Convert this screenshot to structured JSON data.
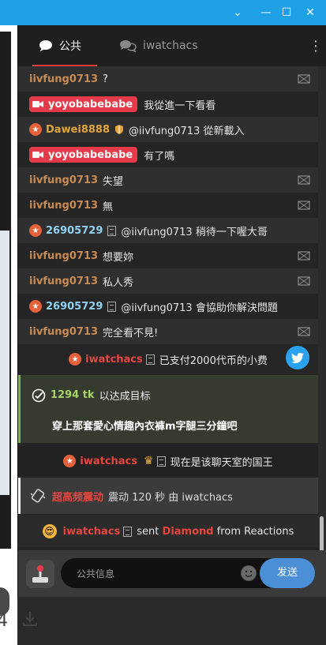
{
  "window": {
    "minimize": "⌄",
    "restore": "—",
    "maximize": "☐",
    "close": "✕"
  },
  "page": {
    "number_fragment": "4"
  },
  "tabs": [
    {
      "label": "公共"
    },
    {
      "label": "iwatchacs"
    }
  ],
  "messages": [
    {
      "user": "iivfung0713",
      "text": "?"
    },
    {
      "user": "yoyobabebabe",
      "text": "我從進一下看看"
    },
    {
      "user": "Dawei8888",
      "text": "@iivfung0713  從新載入"
    },
    {
      "user": "yoyobabebabe",
      "text": "有了嗎"
    },
    {
      "user": "iivfung0713",
      "text": "失望"
    },
    {
      "user": "iivfung0713",
      "text": "無"
    },
    {
      "user": "26905729",
      "text": "@iivfung0713  稍待一下喔大哥"
    },
    {
      "user": "iivfung0713",
      "text": "想要妳"
    },
    {
      "user": "iivfung0713",
      "text": "私人秀"
    },
    {
      "user": "26905729",
      "text": "@iivfung0713  會協助你解決問題"
    },
    {
      "user": "iivfung0713",
      "text": "完全看不見!"
    }
  ],
  "tip": {
    "user": "iwatchacs",
    "text": "已支付2000代币的小费"
  },
  "goal": {
    "amount": "1294 tk",
    "label": "以达成目标",
    "text": "穿上那套愛心情趣內衣褲m字腿三分鐘吧"
  },
  "king": {
    "user": "iwatchacs",
    "text": "现在是该聊天室的国王"
  },
  "vibe": {
    "title": "超高频震动",
    "text": "震动 120 秒 由 iwatchacs"
  },
  "gift": {
    "user": "iwatchacs",
    "sent": "sent",
    "item": "Diamond",
    "from": "from Reactions"
  },
  "input": {
    "placeholder": "公共信息",
    "send": "发送"
  },
  "colors": {
    "accent": "#e03a3a",
    "send": "#4b8fd6",
    "titlebar": "#1ea1e6"
  }
}
